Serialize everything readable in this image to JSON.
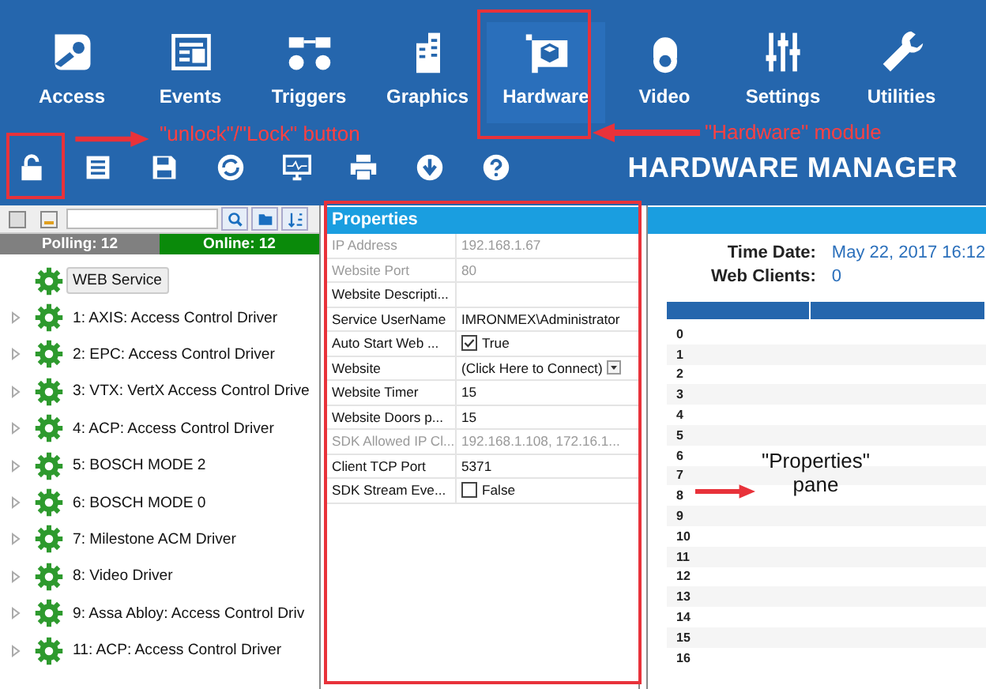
{
  "modules": [
    {
      "label": "Access",
      "selected": false
    },
    {
      "label": "Events",
      "selected": false
    },
    {
      "label": "Triggers",
      "selected": false
    },
    {
      "label": "Graphics",
      "selected": false
    },
    {
      "label": "Hardware",
      "selected": true
    },
    {
      "label": "Video",
      "selected": false
    },
    {
      "label": "Settings",
      "selected": false
    },
    {
      "label": "Utilities",
      "selected": false
    }
  ],
  "manager_title": "HARDWARE MANAGER",
  "tree": {
    "polling": "Polling:  12",
    "online": "Online:  12",
    "items": [
      {
        "label": "WEB Service",
        "expandable": false,
        "selected": true
      },
      {
        "label": "1:  AXIS: Access Control Driver",
        "expandable": true,
        "selected": false
      },
      {
        "label": "2:  EPC: Access Control Driver",
        "expandable": true,
        "selected": false
      },
      {
        "label": "3:  VTX: VertX Access Control Drive",
        "expandable": true,
        "selected": false
      },
      {
        "label": "4:  ACP: Access Control Driver",
        "expandable": true,
        "selected": false
      },
      {
        "label": "5:  BOSCH MODE 2",
        "expandable": true,
        "selected": false
      },
      {
        "label": "6:  BOSCH MODE 0",
        "expandable": true,
        "selected": false
      },
      {
        "label": "7:  Milestone ACM Driver",
        "expandable": true,
        "selected": false
      },
      {
        "label": "8:  Video Driver",
        "expandable": true,
        "selected": false
      },
      {
        "label": "9:  Assa Abloy: Access Control Driv",
        "expandable": true,
        "selected": false
      },
      {
        "label": "11:  ACP: Access Control Driver",
        "expandable": true,
        "selected": false
      }
    ]
  },
  "properties": {
    "title": "Properties",
    "rows": [
      {
        "name": "IP Address",
        "value": "192.168.1.67",
        "kind": "text",
        "readonly": true
      },
      {
        "name": "Website Port",
        "value": "80",
        "kind": "text",
        "readonly": true
      },
      {
        "name": "Website Descripti...",
        "kind": "text",
        "readonly": false
      },
      {
        "name": "Service UserName",
        "value": "IMRONMEX\\Administrator",
        "kind": "text",
        "readonly": false
      },
      {
        "name": "Auto Start Web ...",
        "value": "True",
        "kind": "checkbox",
        "checked": true,
        "readonly": false
      },
      {
        "name": "Website",
        "value": "(Click Here to Connect)",
        "kind": "dropdown",
        "readonly": false
      },
      {
        "name": "Website Timer",
        "value": "15",
        "kind": "text",
        "readonly": false
      },
      {
        "name": "Website Doors p...",
        "value": "15",
        "kind": "text",
        "readonly": false
      },
      {
        "name": "SDK Allowed IP Cl...",
        "value": "192.168.1.108, 172.16.1...",
        "kind": "text",
        "readonly": true
      },
      {
        "name": "Client TCP Port",
        "value": "5371",
        "kind": "text",
        "readonly": false
      },
      {
        "name": "SDK Stream Eve...",
        "value": "False",
        "kind": "checkbox",
        "checked": false,
        "readonly": false
      }
    ]
  },
  "info": {
    "time_label": "Time Date:",
    "time_value": "May 22, 2017   16:12",
    "clients_label": "Web Clients:",
    "clients_value": "0"
  },
  "table": {
    "rows": [
      "0",
      "1",
      "2",
      "3",
      "4",
      "5",
      "6",
      "7",
      "8",
      "9",
      "10",
      "11",
      "12",
      "13",
      "14",
      "15",
      "16"
    ]
  },
  "annotations": [
    {
      "text": "\"unlock\"/\"Lock\" button"
    },
    {
      "text": "\"Hardware\" module"
    },
    {
      "text": "\"Properties\"\npane"
    }
  ]
}
